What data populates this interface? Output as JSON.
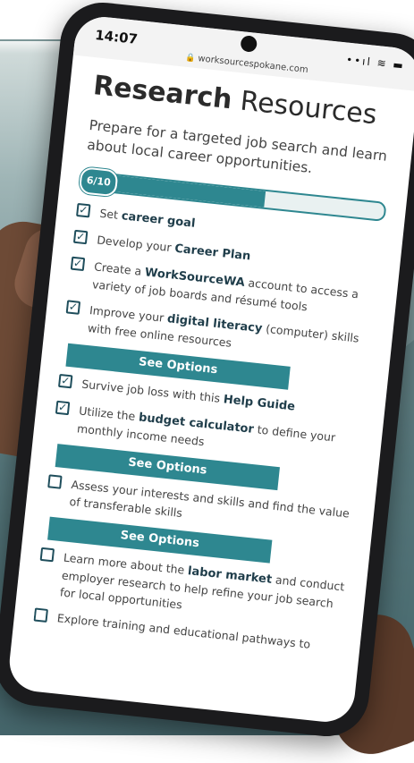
{
  "status_bar": {
    "time": "14:07",
    "url": "worksourcespokane.com",
    "icons": "••ıl  ≋  ▬"
  },
  "page": {
    "title_bold": "Research",
    "title_rest": "Resources",
    "subtitle": "Prepare for a targeted job search and learn about local career opportunities.",
    "progress": {
      "label": "6/10",
      "value": 6,
      "max": 10
    }
  },
  "checklist": [
    {
      "checked": true,
      "pre": "Set ",
      "bold": "career goal",
      "post": ""
    },
    {
      "checked": true,
      "pre": "Develop your ",
      "bold": "Career Plan",
      "post": ""
    },
    {
      "checked": true,
      "pre": "Create a ",
      "bold": "WorkSourceWA",
      "post": " account to access a variety of job boards and résumé tools"
    },
    {
      "checked": true,
      "pre": "Improve your ",
      "bold": "digital literacy",
      "post": " (computer) skills with free online resources",
      "button": "See Options"
    },
    {
      "checked": true,
      "pre": "Survive job loss with this ",
      "bold": "Help Guide",
      "post": ""
    },
    {
      "checked": true,
      "pre": "Utilize the ",
      "bold": "budget calculator",
      "post": " to define your monthly income needs",
      "button": "See Options"
    },
    {
      "checked": false,
      "pre": "Assess your interests and skills and find the value of transferable skills",
      "bold": "",
      "post": "",
      "button": "See Options"
    },
    {
      "checked": false,
      "pre": "Learn more about the ",
      "bold": "labor market",
      "post": " and conduct employer research to help refine your job search for local opportunities"
    },
    {
      "checked": false,
      "pre": "Explore training and educational pathways to",
      "bold": "",
      "post": ""
    }
  ],
  "colors": {
    "teal": "#2e8790",
    "dark": "#1f4e5c"
  }
}
